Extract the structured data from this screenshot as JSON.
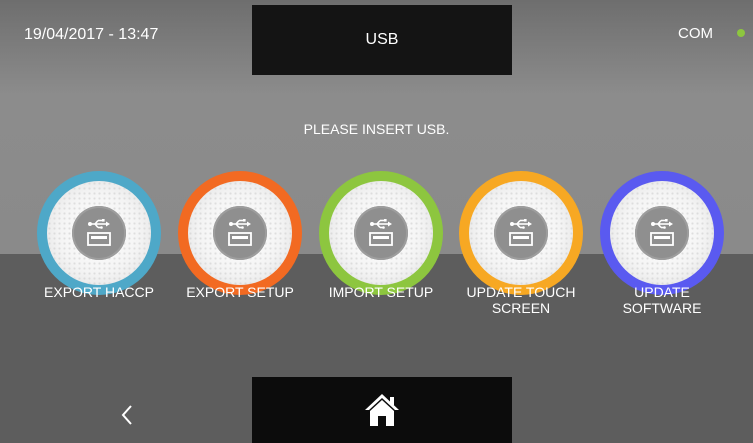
{
  "header": {
    "datetime": "19/04/2017 - 13:47",
    "title": "USB",
    "status_label": "COM",
    "status_color": "#8dc63f"
  },
  "message": "PLEASE INSERT USB.",
  "tiles": [
    {
      "label_line1": "EXPORT HACCP",
      "label_line2": "",
      "ring_color": "#4ea8c8",
      "icon": "usb-drive-icon"
    },
    {
      "label_line1": "EXPORT SETUP",
      "label_line2": "",
      "ring_color": "#f26a22",
      "icon": "usb-drive-icon"
    },
    {
      "label_line1": "IMPORT SETUP",
      "label_line2": "",
      "ring_color": "#8dc63f",
      "icon": "usb-drive-icon"
    },
    {
      "label_line1": "UPDATE TOUCH",
      "label_line2": "SCREEN",
      "ring_color": "#f7a823",
      "icon": "usb-drive-icon"
    },
    {
      "label_line1": "UPDATE",
      "label_line2": "SOFTWARE",
      "ring_color": "#5a5af0",
      "icon": "usb-drive-icon"
    }
  ],
  "footer": {
    "back_icon": "chevron-left-icon",
    "home_icon": "home-icon"
  }
}
